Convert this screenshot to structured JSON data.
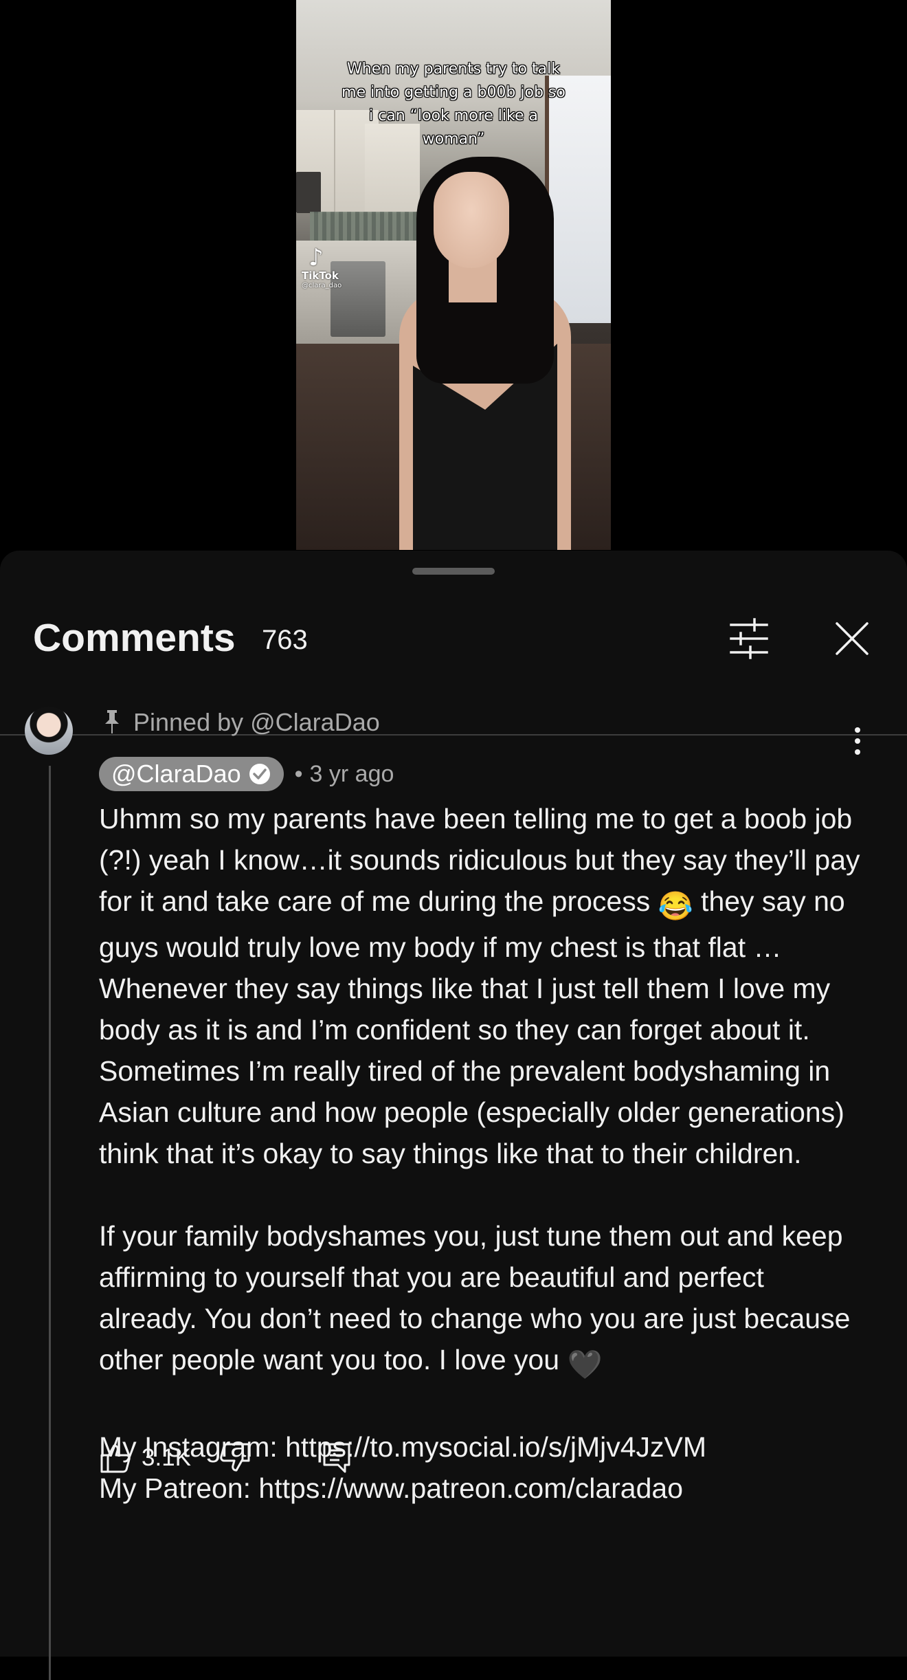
{
  "video": {
    "caption": "When my parents try to talk me into getting a b00b job so i can “look more like a woman”",
    "watermark": {
      "brand": "TikTok",
      "username": "@clara_dao"
    }
  },
  "comments_panel": {
    "title": "Comments",
    "count": "763",
    "icons": {
      "filter": "sliders-icon",
      "close": "close-icon"
    }
  },
  "comment": {
    "pinned_text": "Pinned by @ClaraDao",
    "author": "@ClaraDao",
    "separator": "•",
    "timestamp": "3 yr ago",
    "paragraph1_a": "Uhmm so my parents have been telling me to get a boob job (?!) yeah I know…it sounds ridiculous but they say they’ll pay for it and take care of me during the process ",
    "emoji1": "😂",
    "paragraph1_b": " they say no guys would truly love my body if my chest is that flat …Whenever they say things like that I just tell them I love my body as it is and I’m confident so they can forget about it. Sometimes I’m really tired of the prevalent bodyshaming in Asian culture and how people (especially older generations) think that it’s okay to say things like that to their children.",
    "paragraph2": "If your family bodyshames you, just tune them out and keep affirming to yourself that you are beautiful and perfect already. You don’t need to change who you are just because other people want you too. I love you ",
    "emoji2": "🖤",
    "instagram": "My Instagram: https://to.mysocial.io/s/jMjv4JzVM",
    "patreon": "My Patreon: https://www.patreon.com/claradao",
    "like_count": "3.1K",
    "icons": {
      "like": "thumbs-up-icon",
      "dislike": "thumbs-down-icon",
      "reply": "reply-icon",
      "more": "more-vert-icon",
      "pin": "pin-icon",
      "verified": "verified-check-icon"
    }
  }
}
